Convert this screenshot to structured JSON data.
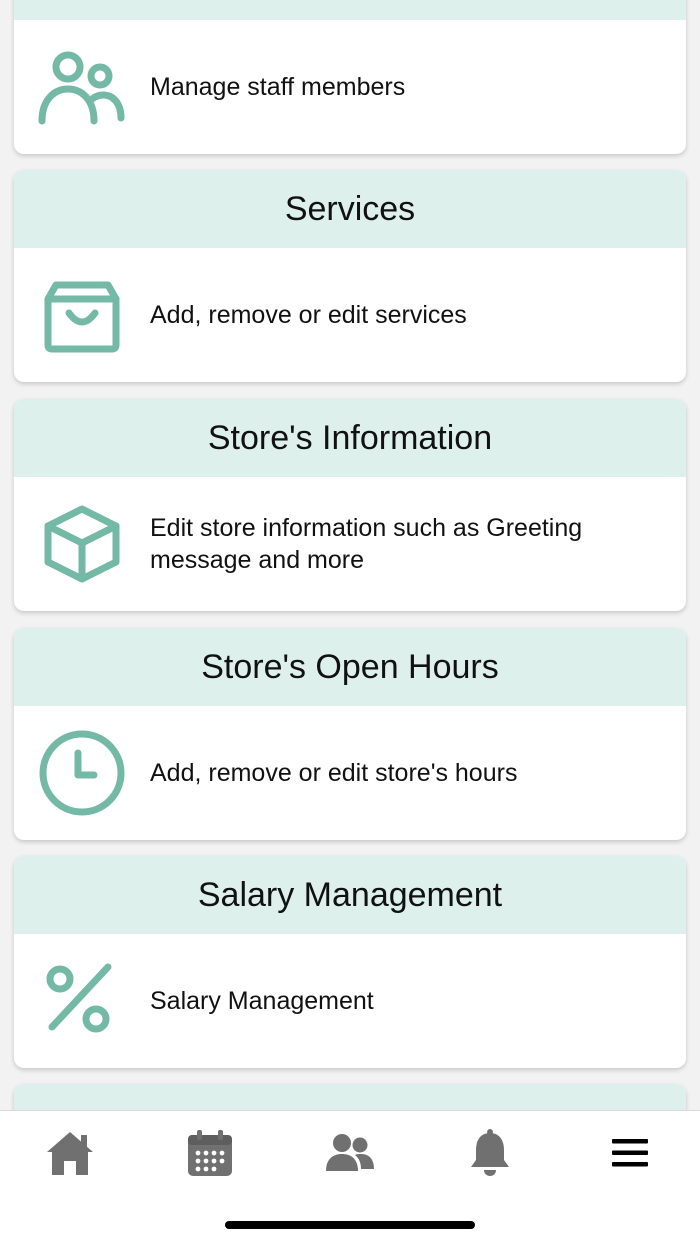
{
  "colors": {
    "accent": "#73b9a5",
    "header_bg": "#ddf0eb",
    "tab_icon": "#707070",
    "tab_icon_active": "#000000"
  },
  "cards": [
    {
      "id": "staff",
      "title": "",
      "icon": "users-icon",
      "description": "Manage staff members"
    },
    {
      "id": "services",
      "title": "Services",
      "icon": "shopping-bag-icon",
      "description": "Add, remove or edit services"
    },
    {
      "id": "store-info",
      "title": "Store's Information",
      "icon": "box-icon",
      "description": "Edit store information such as Greeting message and more"
    },
    {
      "id": "open-hours",
      "title": "Store's Open Hours",
      "icon": "clock-icon",
      "description": "Add, remove or edit store's hours"
    },
    {
      "id": "salary",
      "title": "Salary Management",
      "icon": "percent-icon",
      "description": "Salary Management"
    }
  ],
  "tabbar": {
    "items": [
      {
        "name": "home",
        "icon": "home-icon"
      },
      {
        "name": "calendar",
        "icon": "calendar-icon"
      },
      {
        "name": "staff",
        "icon": "users-icon"
      },
      {
        "name": "notifications",
        "icon": "bell-icon"
      },
      {
        "name": "menu",
        "icon": "menu-icon",
        "active": true
      }
    ]
  }
}
